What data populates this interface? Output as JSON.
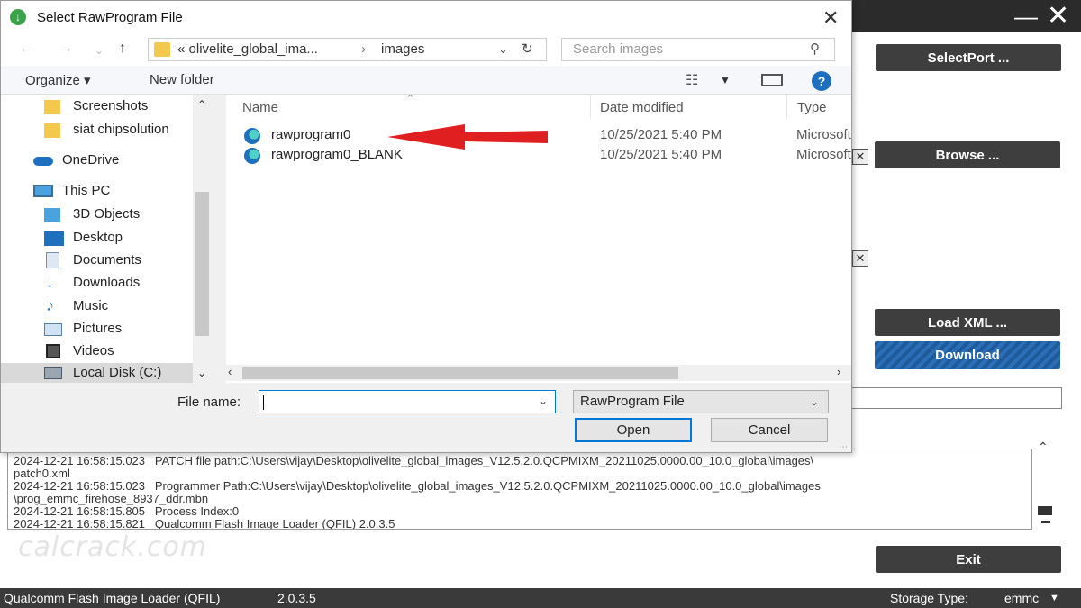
{
  "qfil": {
    "buttons": {
      "select_port": "SelectPort ...",
      "browse": "Browse ...",
      "load_xml": "Load XML ...",
      "download": "Download",
      "exit": "Exit"
    },
    "log": [
      "2024-12-21 16:58:15.023   PATCH file path:C:\\Users\\vijay\\Desktop\\olivelite_global_images_V12.5.2.0.QCPMIXM_20211025.0000.00_10.0_global\\images\\",
      "patch0.xml",
      "2024-12-21 16:58:15.023   Programmer Path:C:\\Users\\vijay\\Desktop\\olivelite_global_images_V12.5.2.0.QCPMIXM_20211025.0000.00_10.0_global\\images",
      "\\prog_emmc_firehose_8937_ddr.mbn",
      "2024-12-21 16:58:15.805   Process Index:0",
      "2024-12-21 16:58:15.821   Qualcomm Flash Image Loader (QFIL) 2.0.3.5"
    ],
    "watermark": "calcrack.com",
    "statusbar": {
      "app_name": "Qualcomm Flash Image Loader (QFIL)",
      "version": "2.0.3.5",
      "storage_label": "Storage Type:",
      "storage_value": "emmc"
    }
  },
  "dialog": {
    "title": "Select RawProgram File",
    "address": {
      "prefix": "«",
      "crumb1": "olivelite_global_ima...",
      "separator": "›",
      "crumb2": "images"
    },
    "search_placeholder": "Search images",
    "toolbar": {
      "organize": "Organize ▾",
      "new_folder": "New folder"
    },
    "nav_items": [
      {
        "label": "Screenshots",
        "icon": "folder-icon"
      },
      {
        "label": "siat chipsolution",
        "icon": "folder-icon"
      },
      {
        "label": "OneDrive",
        "icon": "onedrive-icon"
      },
      {
        "label": "This PC",
        "icon": "computer-icon"
      },
      {
        "label": "3D Objects",
        "icon": "3d-objects-icon"
      },
      {
        "label": "Desktop",
        "icon": "desktop-icon"
      },
      {
        "label": "Documents",
        "icon": "documents-icon"
      },
      {
        "label": "Downloads",
        "icon": "downloads-icon"
      },
      {
        "label": "Music",
        "icon": "music-icon"
      },
      {
        "label": "Pictures",
        "icon": "pictures-icon"
      },
      {
        "label": "Videos",
        "icon": "videos-icon"
      },
      {
        "label": "Local Disk (C:)",
        "icon": "disk-icon"
      }
    ],
    "columns": {
      "name": "Name",
      "date_modified": "Date modified",
      "type": "Type"
    },
    "files": [
      {
        "name": "rawprogram0",
        "date": "10/25/2021 5:40 PM",
        "type": "Microsoft Edge"
      },
      {
        "name": "rawprogram0_BLANK",
        "date": "10/25/2021 5:40 PM",
        "type": "Microsoft Edge"
      }
    ],
    "file_name_label": "File name:",
    "file_name_value": "",
    "file_type": "RawProgram File",
    "open_label": "Open",
    "cancel_label": "Cancel"
  },
  "colors": {
    "annotation_arrow": "#e02020",
    "accent": "#0078d7",
    "qfil_button": "#3e3e3e"
  }
}
